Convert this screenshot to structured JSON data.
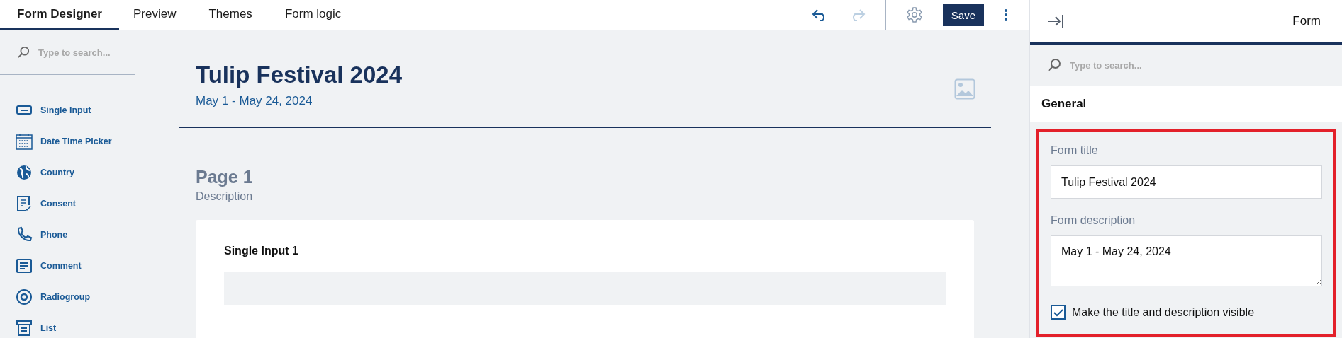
{
  "tabs": [
    {
      "label": "Form Designer",
      "selected": true
    },
    {
      "label": "Preview",
      "selected": false
    },
    {
      "label": "Themes",
      "selected": false
    },
    {
      "label": "Form logic",
      "selected": false
    }
  ],
  "toolbar": {
    "undo_disabled": false,
    "redo_disabled": true,
    "save": "Save"
  },
  "toolbox": {
    "search_placeholder": "Type to search...",
    "items": [
      {
        "label": "Single Input",
        "kind": "input"
      },
      {
        "label": "Date Time Picker",
        "kind": "date"
      },
      {
        "label": "Country",
        "kind": "globe"
      },
      {
        "label": "Consent",
        "kind": "consent"
      },
      {
        "label": "Phone",
        "kind": "phone"
      },
      {
        "label": "Comment",
        "kind": "comment"
      },
      {
        "label": "Radiogroup",
        "kind": "radio"
      },
      {
        "label": "List",
        "kind": "list"
      }
    ]
  },
  "form": {
    "title": "Tulip Festival 2024",
    "description": "May 1 - May 24, 2024",
    "page_title": "Page 1",
    "page_description": "Description",
    "question": "Single Input 1"
  },
  "properties": {
    "title": "Form",
    "search_placeholder": "Type to search...",
    "section": "General",
    "highlighted": true,
    "title_label": "Form title",
    "title_value": "Tulip Festival 2024",
    "description_label": "Form description",
    "description_value": "May 1 - May 24, 2024",
    "visible_label": "Make the title and description visible",
    "visible_checked": true
  }
}
